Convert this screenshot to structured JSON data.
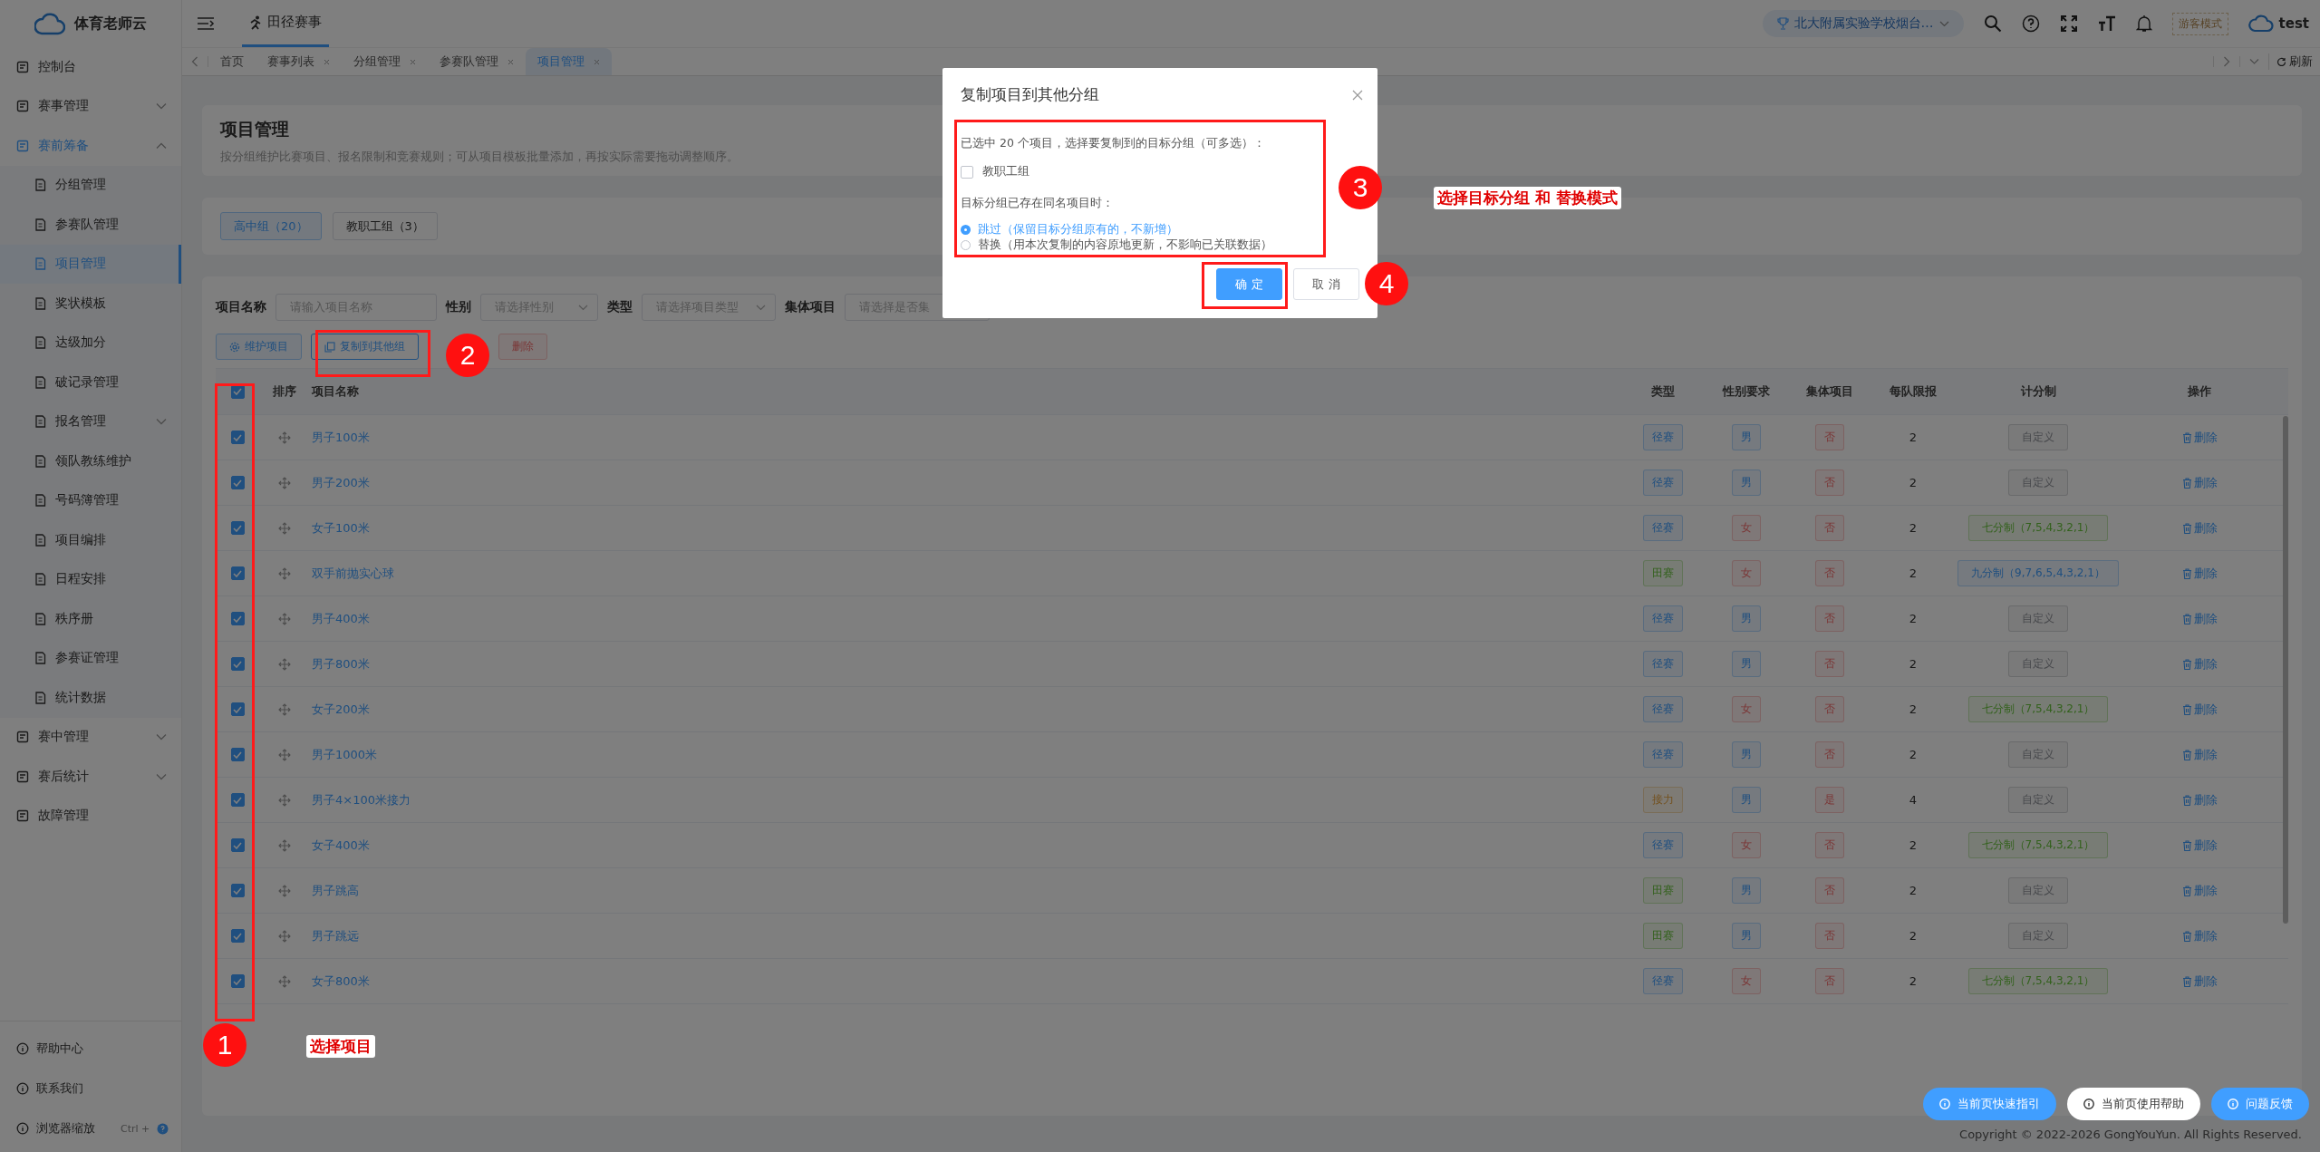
{
  "sidebar": {
    "logo": "体育老师云",
    "items": [
      {
        "label": "控制台",
        "selected": false
      },
      {
        "label": "赛事管理",
        "selected": false,
        "expanded": false
      },
      {
        "label": "赛前筹备",
        "selected": true,
        "expanded": true,
        "children": [
          {
            "label": "分组管理",
            "selected": false
          },
          {
            "label": "参赛队管理",
            "selected": false
          },
          {
            "label": "项目管理",
            "selected": true
          },
          {
            "label": "奖状模板",
            "selected": false
          },
          {
            "label": "达级加分",
            "selected": false
          },
          {
            "label": "破记录管理",
            "selected": false
          },
          {
            "label": "报名管理",
            "selected": false,
            "expanded": false
          },
          {
            "label": "领队教练维护",
            "selected": false
          },
          {
            "label": "号码簿管理",
            "selected": false
          },
          {
            "label": "项目编排",
            "selected": false
          },
          {
            "label": "日程安排",
            "selected": false
          },
          {
            "label": "秩序册",
            "selected": false
          },
          {
            "label": "参赛证管理",
            "selected": false
          },
          {
            "label": "统计数据",
            "selected": false
          }
        ]
      },
      {
        "label": "赛中管理",
        "selected": false,
        "expanded": false
      },
      {
        "label": "赛后统计",
        "selected": false,
        "expanded": false
      },
      {
        "label": "故障管理",
        "selected": false
      }
    ],
    "bottom": [
      {
        "label": "帮助中心"
      },
      {
        "label": "联系我们"
      },
      {
        "label": "浏览器缩放",
        "hint": "Ctrl +"
      }
    ]
  },
  "header": {
    "section": "田径赛事",
    "school": "北大附属实验学校烟台…",
    "guest_badge": "游客模式",
    "user": "test"
  },
  "tabs": [
    {
      "label": "首页",
      "closable": false,
      "selected": false
    },
    {
      "label": "赛事列表",
      "closable": true,
      "selected": false
    },
    {
      "label": "分组管理",
      "closable": true,
      "selected": false
    },
    {
      "label": "参赛队管理",
      "closable": true,
      "selected": false
    },
    {
      "label": "项目管理",
      "closable": true,
      "selected": true
    }
  ],
  "refresh": "刷新",
  "page": {
    "title": "项目管理",
    "description": "按分组维护比赛项目、报名限制和竞赛规则；可从项目模板批量添加，再按实际需要拖动调整顺序。"
  },
  "groups": [
    {
      "label": "高中组（20）",
      "selected": true
    },
    {
      "label": "教职工组（3）",
      "selected": false
    }
  ],
  "filters": [
    {
      "label": "项目名称",
      "placeholder": "请输入项目名称",
      "kind": "input"
    },
    {
      "label": "性别",
      "placeholder": "请选择性别",
      "kind": "select"
    },
    {
      "label": "类型",
      "placeholder": "请选择项目类型",
      "kind": "select"
    },
    {
      "label": "集体项目",
      "placeholder": "请选择是否集",
      "kind": "input"
    }
  ],
  "actions": [
    {
      "label": "维护项目",
      "kind": "primary"
    },
    {
      "label": "复制到其他组",
      "kind": "default"
    },
    {
      "label": "删除",
      "kind": "danger"
    }
  ],
  "table": {
    "all_checked": true,
    "columns": [
      "排序",
      "项目名称",
      "类型",
      "性别要求",
      "集体项目",
      "每队限报",
      "计分制",
      "操作"
    ],
    "rows": [
      {
        "checked": true,
        "name": "男子100米",
        "type": {
          "text": "径赛",
          "kind": "primary"
        },
        "gender": {
          "text": "男",
          "kind": "primary"
        },
        "team": {
          "text": "否",
          "kind": "danger"
        },
        "limit": "2",
        "scoring": {
          "text": "自定义",
          "kind": "info"
        },
        "action": "删除"
      },
      {
        "checked": true,
        "name": "男子200米",
        "type": {
          "text": "径赛",
          "kind": "primary"
        },
        "gender": {
          "text": "男",
          "kind": "primary"
        },
        "team": {
          "text": "否",
          "kind": "danger"
        },
        "limit": "2",
        "scoring": {
          "text": "自定义",
          "kind": "info"
        },
        "action": "删除"
      },
      {
        "checked": true,
        "name": "女子100米",
        "type": {
          "text": "径赛",
          "kind": "primary"
        },
        "gender": {
          "text": "女",
          "kind": "danger"
        },
        "team": {
          "text": "否",
          "kind": "danger"
        },
        "limit": "2",
        "scoring": {
          "text": "七分制（7,5,4,3,2,1）",
          "kind": "success"
        },
        "action": "删除"
      },
      {
        "checked": true,
        "name": "双手前抛实心球",
        "type": {
          "text": "田赛",
          "kind": "success"
        },
        "gender": {
          "text": "女",
          "kind": "danger"
        },
        "team": {
          "text": "否",
          "kind": "danger"
        },
        "limit": "2",
        "scoring": {
          "text": "九分制（9,7,6,5,4,3,2,1）",
          "kind": "primary"
        },
        "action": "删除"
      },
      {
        "checked": true,
        "name": "男子400米",
        "type": {
          "text": "径赛",
          "kind": "primary"
        },
        "gender": {
          "text": "男",
          "kind": "primary"
        },
        "team": {
          "text": "否",
          "kind": "danger"
        },
        "limit": "2",
        "scoring": {
          "text": "自定义",
          "kind": "info"
        },
        "action": "删除"
      },
      {
        "checked": true,
        "name": "男子800米",
        "type": {
          "text": "径赛",
          "kind": "primary"
        },
        "gender": {
          "text": "男",
          "kind": "primary"
        },
        "team": {
          "text": "否",
          "kind": "danger"
        },
        "limit": "2",
        "scoring": {
          "text": "自定义",
          "kind": "info"
        },
        "action": "删除"
      },
      {
        "checked": true,
        "name": "女子200米",
        "type": {
          "text": "径赛",
          "kind": "primary"
        },
        "gender": {
          "text": "女",
          "kind": "danger"
        },
        "team": {
          "text": "否",
          "kind": "danger"
        },
        "limit": "2",
        "scoring": {
          "text": "七分制（7,5,4,3,2,1）",
          "kind": "success"
        },
        "action": "删除"
      },
      {
        "checked": true,
        "name": "男子1000米",
        "type": {
          "text": "径赛",
          "kind": "primary"
        },
        "gender": {
          "text": "男",
          "kind": "primary"
        },
        "team": {
          "text": "否",
          "kind": "danger"
        },
        "limit": "2",
        "scoring": {
          "text": "自定义",
          "kind": "info"
        },
        "action": "删除"
      },
      {
        "checked": true,
        "name": "男子4×100米接力",
        "type": {
          "text": "接力",
          "kind": "warning"
        },
        "gender": {
          "text": "男",
          "kind": "primary"
        },
        "team": {
          "text": "是",
          "kind": "danger"
        },
        "limit": "4",
        "scoring": {
          "text": "自定义",
          "kind": "info"
        },
        "action": "删除"
      },
      {
        "checked": true,
        "name": "女子400米",
        "type": {
          "text": "径赛",
          "kind": "primary"
        },
        "gender": {
          "text": "女",
          "kind": "danger"
        },
        "team": {
          "text": "否",
          "kind": "danger"
        },
        "limit": "2",
        "scoring": {
          "text": "七分制（7,5,4,3,2,1）",
          "kind": "success"
        },
        "action": "删除"
      },
      {
        "checked": true,
        "name": "男子跳高",
        "type": {
          "text": "田赛",
          "kind": "success"
        },
        "gender": {
          "text": "男",
          "kind": "primary"
        },
        "team": {
          "text": "否",
          "kind": "danger"
        },
        "limit": "2",
        "scoring": {
          "text": "自定义",
          "kind": "info"
        },
        "action": "删除"
      },
      {
        "checked": true,
        "name": "男子跳远",
        "type": {
          "text": "田赛",
          "kind": "success"
        },
        "gender": {
          "text": "男",
          "kind": "primary"
        },
        "team": {
          "text": "否",
          "kind": "danger"
        },
        "limit": "2",
        "scoring": {
          "text": "自定义",
          "kind": "info"
        },
        "action": "删除"
      },
      {
        "checked": true,
        "name": "女子800米",
        "type": {
          "text": "径赛",
          "kind": "primary"
        },
        "gender": {
          "text": "女",
          "kind": "danger"
        },
        "team": {
          "text": "否",
          "kind": "danger"
        },
        "limit": "2",
        "scoring": {
          "text": "七分制（7,5,4,3,2,1）",
          "kind": "success"
        },
        "action": "删除"
      }
    ]
  },
  "help_buttons": [
    {
      "label": "当前页快速指引",
      "kind": "primary"
    },
    {
      "label": "当前页使用帮助",
      "kind": "default"
    },
    {
      "label": "问题反馈",
      "kind": "primary"
    }
  ],
  "copyright": "Copyright © 2022-2026 GongYouYun. All Rights Reserved.",
  "dialog": {
    "title": "复制项目到其他分组",
    "intro": "已选中 20 个项目，选择要复制到的目标分组（可多选）：",
    "groups": [
      {
        "label": "教职工组",
        "checked": false
      }
    ],
    "conflict_label": "目标分组已存在同名项目时：",
    "modes": [
      {
        "label": "跳过（保留目标分组原有的，不新增）",
        "selected": true
      },
      {
        "label": "替换（用本次复制的内容原地更新，不影响已关联数据）",
        "selected": false
      }
    ],
    "buttons": [
      {
        "label": "确 定",
        "kind": "primary"
      },
      {
        "label": "取 消",
        "kind": "default"
      }
    ]
  },
  "annotations": {
    "steps": [
      "1",
      "2",
      "3",
      "4"
    ],
    "notes": [
      "选择项目",
      "选择目标分组 和 替换模式"
    ]
  }
}
